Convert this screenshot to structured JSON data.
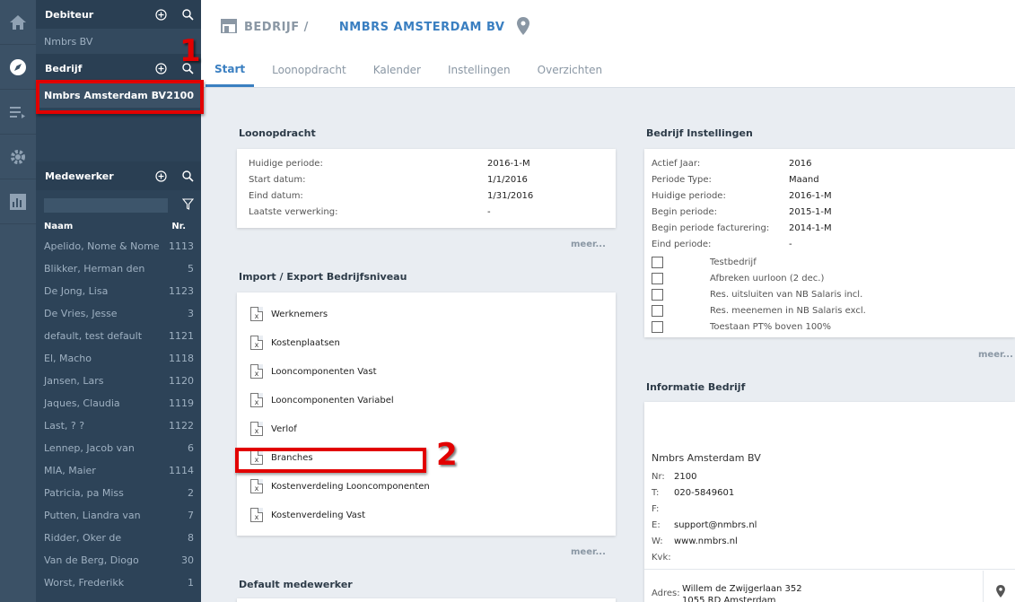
{
  "sidebar": {
    "debiteur": {
      "title": "Debiteur",
      "item": "Nmbrs BV"
    },
    "bedrijf": {
      "title": "Bedrijf",
      "company_name": "Nmbrs Amsterdam BV",
      "company_nr": "2100"
    },
    "medewerker": {
      "title": "Medewerker",
      "col_name": "Naam",
      "col_nr": "Nr.",
      "employees": [
        {
          "name": "Apelido, Nome & Nome",
          "nr": "1113"
        },
        {
          "name": "Blikker, Herman den",
          "nr": "5"
        },
        {
          "name": "De Jong, Lisa",
          "nr": "1123"
        },
        {
          "name": "De Vries, Jesse",
          "nr": "3"
        },
        {
          "name": "default, test default",
          "nr": "1121"
        },
        {
          "name": "El, Macho",
          "nr": "1118"
        },
        {
          "name": "Jansen, Lars",
          "nr": "1120"
        },
        {
          "name": "Jaques, Claudia",
          "nr": "1119"
        },
        {
          "name": "Last, ? ?",
          "nr": "1122"
        },
        {
          "name": "Lennep, Jacob van",
          "nr": "6"
        },
        {
          "name": "MIA, Maier",
          "nr": "1114"
        },
        {
          "name": "Patricia, pa Miss",
          "nr": "2"
        },
        {
          "name": "Putten, Liandra van",
          "nr": "7"
        },
        {
          "name": "Ridder, Oker de",
          "nr": "8"
        },
        {
          "name": "Van de Berg, Diogo",
          "nr": "30"
        },
        {
          "name": "Worst, Frederikk",
          "nr": "1"
        }
      ]
    }
  },
  "annotations": {
    "one": "1",
    "two": "2"
  },
  "header": {
    "crumb": "BEDRIJF /",
    "company": "NMBRS AMSTERDAM BV"
  },
  "tabs": [
    "Start",
    "Loonopdracht",
    "Kalender",
    "Instellingen",
    "Overzichten"
  ],
  "loonopdracht": {
    "title": "Loonopdracht",
    "rows": [
      {
        "k": "Huidige periode:",
        "v": "2016-1-M"
      },
      {
        "k": "Start datum:",
        "v": "1/1/2016"
      },
      {
        "k": "Eind datum:",
        "v": "1/31/2016"
      },
      {
        "k": "Laatste verwerking:",
        "v": "-"
      }
    ],
    "meer": "meer..."
  },
  "import_export": {
    "title": "Import / Export Bedrijfsniveau",
    "items": [
      "Werknemers",
      "Kostenplaatsen",
      "Looncomponenten Vast",
      "Looncomponenten Variabel",
      "Verlof",
      "Branches",
      "Kostenverdeling Looncomponenten",
      "Kostenverdeling Vast"
    ],
    "meer": "meer..."
  },
  "default_medewerker": {
    "title": "Default medewerker"
  },
  "bedrijf_instellingen": {
    "title": "Bedrijf Instellingen",
    "rows": [
      {
        "k": "Actief Jaar:",
        "v": "2016"
      },
      {
        "k": "Periode Type:",
        "v": "Maand"
      },
      {
        "k": "Huidige periode:",
        "v": "2016-1-M"
      },
      {
        "k": "Begin periode:",
        "v": "2015-1-M"
      },
      {
        "k": "Begin periode facturering:",
        "v": "2014-1-M"
      },
      {
        "k": "Eind periode:",
        "v": "-"
      }
    ],
    "checkboxes": [
      "Testbedrijf",
      "Afbreken uurloon (2 dec.)",
      "Res. uitsluiten van NB Salaris incl.",
      "Res. meenemen in NB Salaris excl.",
      "Toestaan PT% boven 100%"
    ],
    "meer": "meer..."
  },
  "informatie": {
    "title": "Informatie Bedrijf",
    "company": "Nmbrs Amsterdam BV",
    "lines": [
      {
        "k": "Nr:",
        "v": "2100"
      },
      {
        "k": "T:",
        "v": "020-5849601"
      },
      {
        "k": "F:",
        "v": ""
      },
      {
        "k": "E:",
        "v": "support@nmbrs.nl"
      },
      {
        "k": "W:",
        "v": "www.nmbrs.nl"
      },
      {
        "k": "Kvk:",
        "v": ""
      }
    ],
    "adres_label": "Adres:",
    "adres_line1": "Willem de Zwijgerlaan 352",
    "adres_line2": "1055 RD Amsterdam"
  }
}
